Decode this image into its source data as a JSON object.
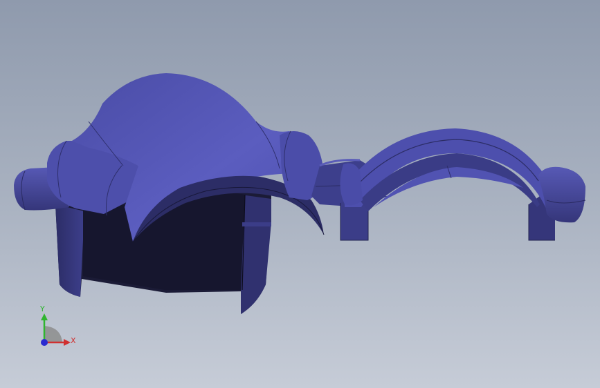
{
  "viewport": {
    "background_top": "#8f9aad",
    "background_bottom": "#c6ccd7",
    "model_color": "#5a5cb8"
  },
  "triad": {
    "x_label": "X",
    "y_label": "Y",
    "x_color": "#d03030",
    "y_color": "#2fb52f",
    "z_color": "#2a2ad0"
  }
}
